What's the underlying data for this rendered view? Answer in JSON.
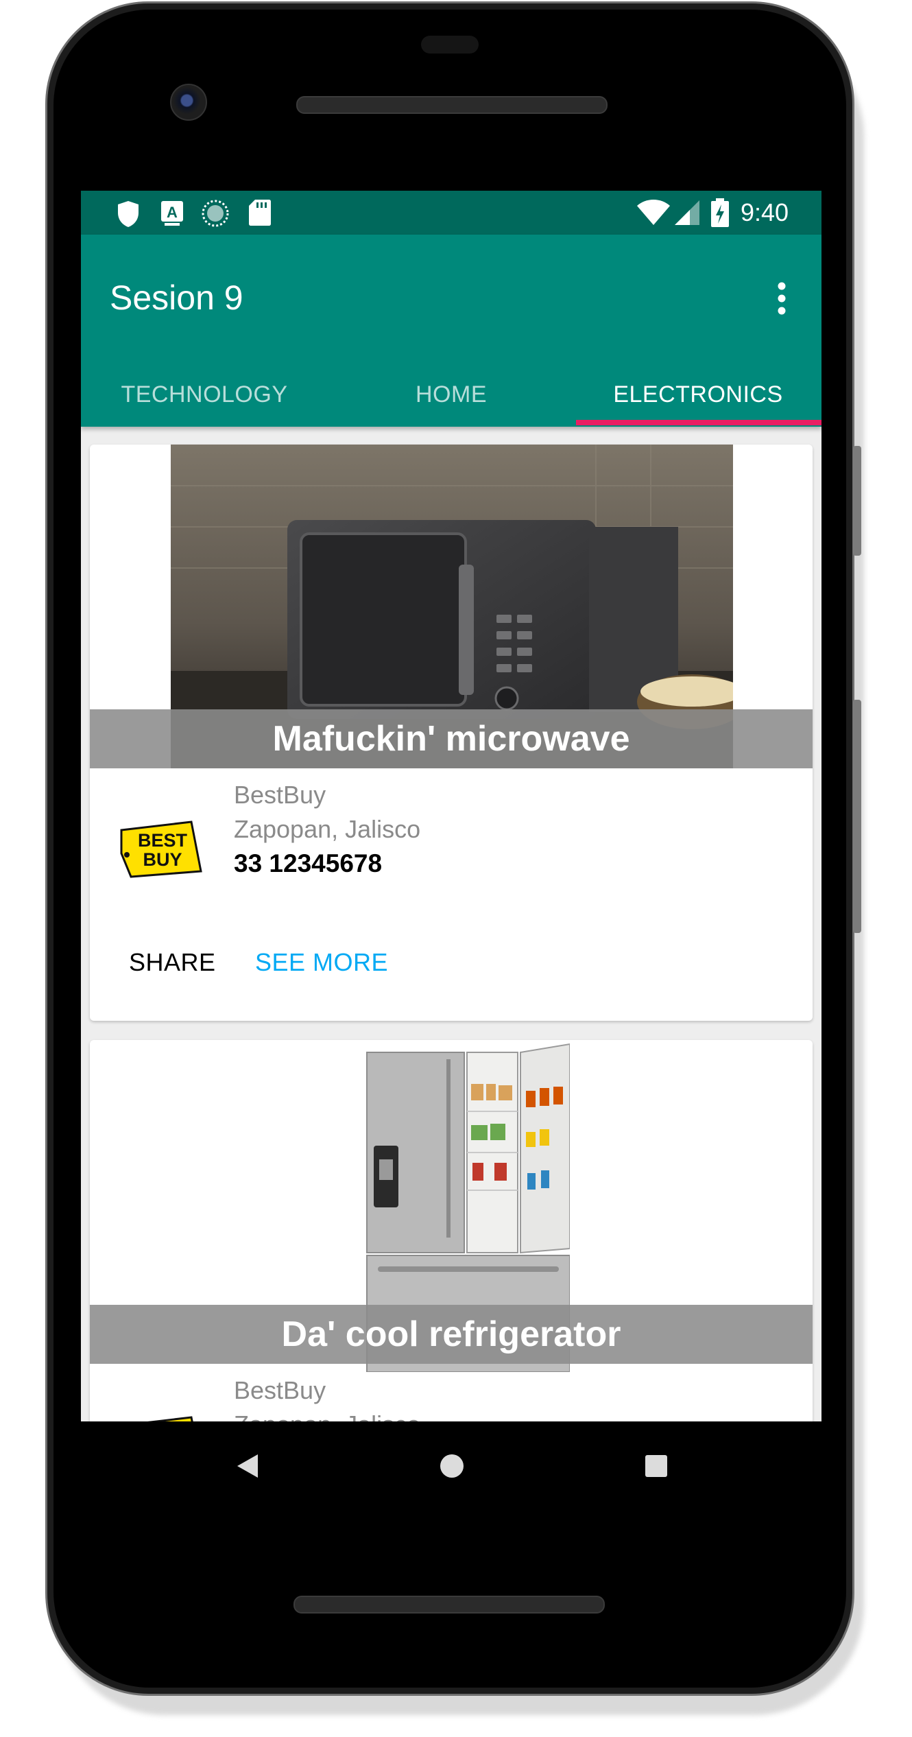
{
  "status_bar": {
    "time": "9:40",
    "left_icons": [
      "shield-icon",
      "a-letter-icon",
      "sync-dots-icon",
      "sd-card-icon"
    ],
    "right_icons": [
      "wifi-icon",
      "signal-icon",
      "battery-charging-icon"
    ]
  },
  "app_bar": {
    "title": "Sesion 9",
    "overflow_icon": "more-vert-icon"
  },
  "tabs": [
    {
      "label": "TECHNOLOGY",
      "active": false
    },
    {
      "label": "HOME",
      "active": false
    },
    {
      "label": "ELECTRONICS",
      "active": true
    }
  ],
  "colors": {
    "status_bar": "#00695c",
    "app_bar": "#00897b",
    "tab_indicator": "#e91e63",
    "see_more": "#03a9f4"
  },
  "cards": [
    {
      "title": "Mafuckin' microwave",
      "store": "BestBuy",
      "location": "Zapopan, Jalisco",
      "phone": "33 12345678",
      "share_label": "SHARE",
      "see_more_label": "SEE MORE",
      "logo_text": "BEST BUY"
    },
    {
      "title": "Da' cool refrigerator",
      "store": "BestBuy",
      "location": "Zapopan, Jalisco"
    }
  ],
  "nav": {
    "back_icon": "back-triangle-icon",
    "home_icon": "home-circle-icon",
    "recents_icon": "recents-square-icon"
  }
}
